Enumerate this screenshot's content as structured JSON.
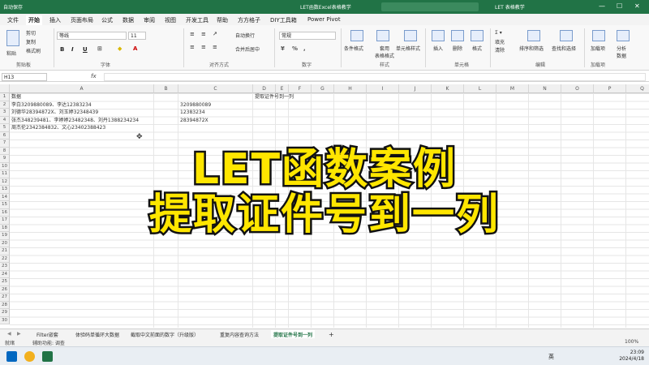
{
  "titlebar": {
    "autosave": "自动保存",
    "window_title": "LET函数Excel表格教学",
    "user": "LET 表格教学",
    "minimize": "—",
    "maximize": "☐",
    "close": "✕"
  },
  "menu": {
    "tabs": [
      "文件",
      "开始",
      "插入",
      "页面布局",
      "公式",
      "数据",
      "审阅",
      "视图",
      "开发工具",
      "帮助",
      "方方格子",
      "DIY工具箱",
      "Power Pivot"
    ],
    "active": "开始"
  },
  "ribbon": {
    "cut": "剪切",
    "copy": "复制",
    "format_painter": "格式刷",
    "paste": "粘贴",
    "clipboard": "剪贴板",
    "font_name": "等线",
    "font_size": "11",
    "bold": "B",
    "italic": "I",
    "underline": "U",
    "font_group": "字体",
    "wrap_text": "自动换行",
    "merge_center": "合并后居中",
    "alignment_group": "对齐方式",
    "number_format": "常规",
    "number_group": "数字",
    "conditional_format": "条件格式",
    "table_format": "套用\n表格格式",
    "cell_style": "单元格样式",
    "style_group": "样式",
    "insert": "插入",
    "delete": "删除",
    "format": "格式",
    "cells_group": "单元格",
    "fill": "填充",
    "clear": "清除",
    "sort_filter": "排序和筛选",
    "find_select": "查找和选择",
    "edit_group": "编辑",
    "addins": "加载项",
    "addins_group": "加载项",
    "analyze": "分析\n数据"
  },
  "formula_bar": {
    "name_box": "H13",
    "fx": "fx",
    "value": ""
  },
  "grid": {
    "columns": [
      "A",
      "B",
      "C",
      "D",
      "E",
      "F",
      "G",
      "H",
      "I",
      "J",
      "K",
      "L",
      "M",
      "N",
      "O",
      "P",
      "Q"
    ],
    "rows": [
      "1",
      "2",
      "3",
      "4",
      "5",
      "6",
      "7",
      "8",
      "9",
      "10",
      "11",
      "12",
      "13",
      "14",
      "15",
      "16",
      "17",
      "18",
      "19",
      "20",
      "21",
      "22",
      "23",
      "24",
      "25",
      "26",
      "27",
      "28",
      "29",
      "30"
    ],
    "cells": {
      "A1": "数据",
      "A2": "李白3209880089、李达12383234",
      "A3": "刘德华28394872X、刘玉婷32348439",
      "A4": "张杰348239481、李婷婷23482348、刘丹1388234234",
      "A5": "周杰伦2342384832、文心23402388423",
      "D1": "提取证件号到一列",
      "C2": "3209880089",
      "C3": "12383234",
      "C4": "28394872X"
    }
  },
  "overlay": {
    "line1": "LET函数案例",
    "line2": "提取证件号到一列"
  },
  "sheet_tabs": {
    "tabs": [
      "Filter嵌套",
      "体验码单循环大数据",
      "截取中文前面的数字（升级版）",
      "重复内容查询方法",
      "提取证件号到一列"
    ],
    "active": "提取证件号到一列",
    "add": "+"
  },
  "status": {
    "ready": "就绪",
    "accessibility": "辅助功能: 调查",
    "zoom": "100%"
  },
  "taskbar": {
    "time": "23:09",
    "date": "2024/4/18",
    "lang": "英"
  }
}
